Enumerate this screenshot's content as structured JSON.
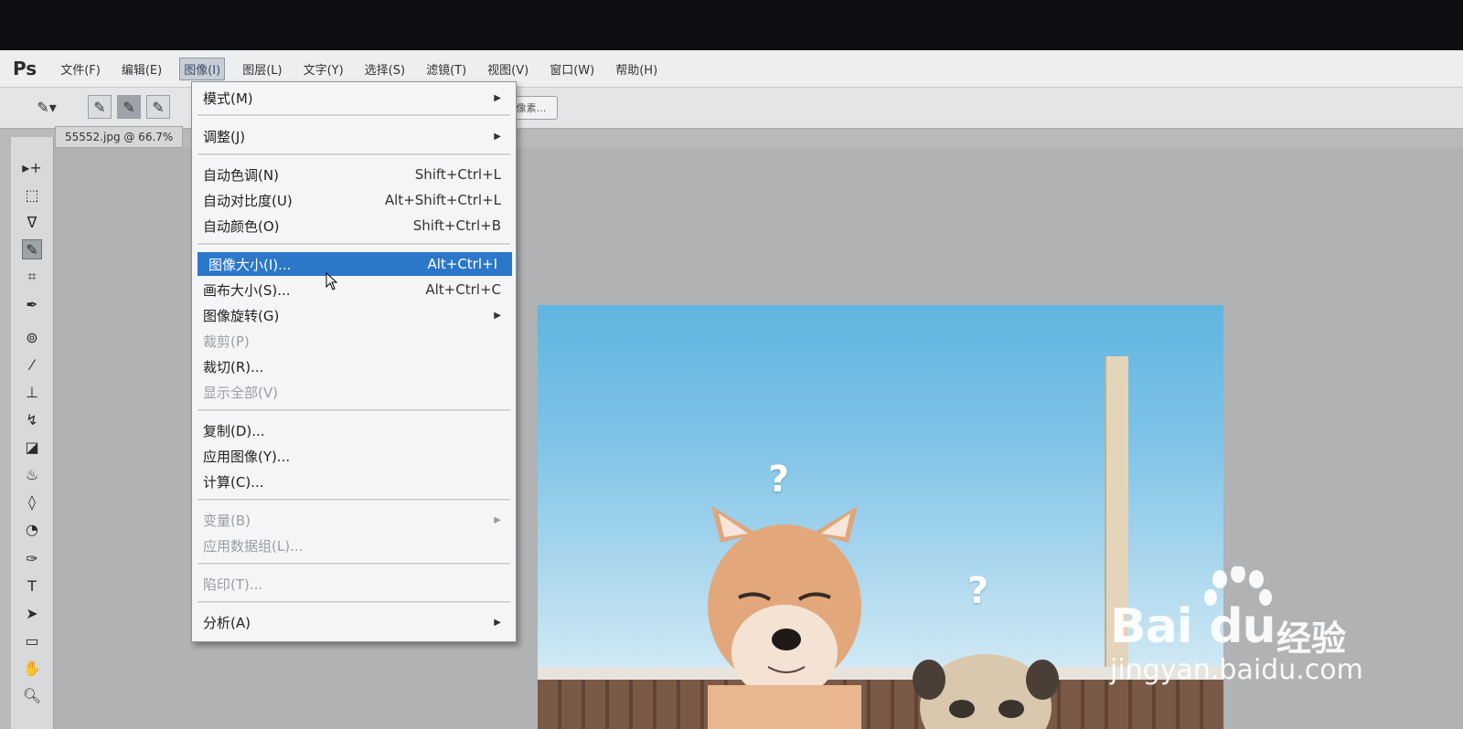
{
  "app": {
    "logo": "Ps"
  },
  "menubar": {
    "items": [
      {
        "label": "文件(F)"
      },
      {
        "label": "编辑(E)"
      },
      {
        "label": "图像(I)"
      },
      {
        "label": "图层(L)"
      },
      {
        "label": "文字(Y)"
      },
      {
        "label": "选择(S)"
      },
      {
        "label": "滤镜(T)"
      },
      {
        "label": "视图(V)"
      },
      {
        "label": "窗口(W)"
      },
      {
        "label": "帮助(H)"
      }
    ]
  },
  "optbar": {
    "field_label": "像素…"
  },
  "document": {
    "tab_label": "55552.jpg @ 66.7%"
  },
  "image_menu": {
    "items": [
      {
        "label": "模式(M)",
        "shortcut": "",
        "submenu": true,
        "disabled": false
      },
      {
        "label": "调整(J)",
        "shortcut": "",
        "submenu": true,
        "disabled": false
      },
      {
        "label": "自动色调(N)",
        "shortcut": "Shift+Ctrl+L",
        "submenu": false,
        "disabled": false
      },
      {
        "label": "自动对比度(U)",
        "shortcut": "Alt+Shift+Ctrl+L",
        "submenu": false,
        "disabled": false
      },
      {
        "label": "自动颜色(O)",
        "shortcut": "Shift+Ctrl+B",
        "submenu": false,
        "disabled": false
      },
      {
        "label": "图像大小(I)...",
        "shortcut": "Alt+Ctrl+I",
        "submenu": false,
        "disabled": false,
        "highlighted": true
      },
      {
        "label": "画布大小(S)...",
        "shortcut": "Alt+Ctrl+C",
        "submenu": false,
        "disabled": false
      },
      {
        "label": "图像旋转(G)",
        "shortcut": "",
        "submenu": true,
        "disabled": false
      },
      {
        "label": "裁剪(P)",
        "shortcut": "",
        "submenu": false,
        "disabled": true
      },
      {
        "label": "裁切(R)...",
        "shortcut": "",
        "submenu": false,
        "disabled": false
      },
      {
        "label": "显示全部(V)",
        "shortcut": "",
        "submenu": false,
        "disabled": true
      },
      {
        "label": "复制(D)...",
        "shortcut": "",
        "submenu": false,
        "disabled": false
      },
      {
        "label": "应用图像(Y)...",
        "shortcut": "",
        "submenu": false,
        "disabled": false
      },
      {
        "label": "计算(C)...",
        "shortcut": "",
        "submenu": false,
        "disabled": false
      },
      {
        "label": "变量(B)",
        "shortcut": "",
        "submenu": true,
        "disabled": true
      },
      {
        "label": "应用数据组(L)...",
        "shortcut": "",
        "submenu": false,
        "disabled": true
      },
      {
        "label": "陷印(T)...",
        "shortcut": "",
        "submenu": false,
        "disabled": true
      },
      {
        "label": "分析(A)",
        "shortcut": "",
        "submenu": true,
        "disabled": false
      }
    ]
  },
  "canvas": {
    "qmark1": "?",
    "qmark2": "?"
  },
  "watermark": {
    "brand": "Bai",
    "brand2": "du",
    "jingyan": "经验",
    "url": "jingyan.baidu.com"
  },
  "colors": {
    "highlight": "#2b77c9",
    "menu_bg": "#f4f5f6",
    "disabled": "#9a9ea3"
  },
  "icons": [
    "move-icon",
    "marquee-icon",
    "lasso-icon",
    "quick-select-icon",
    "crop-icon",
    "eyedropper-icon",
    "healing-icon",
    "brush-icon",
    "stamp-icon",
    "history-brush-icon",
    "eraser-icon",
    "gradient-icon",
    "blur-icon",
    "dodge-icon",
    "pen-icon",
    "type-icon",
    "path-select-icon",
    "shape-icon",
    "hand-icon",
    "zoom-icon"
  ]
}
